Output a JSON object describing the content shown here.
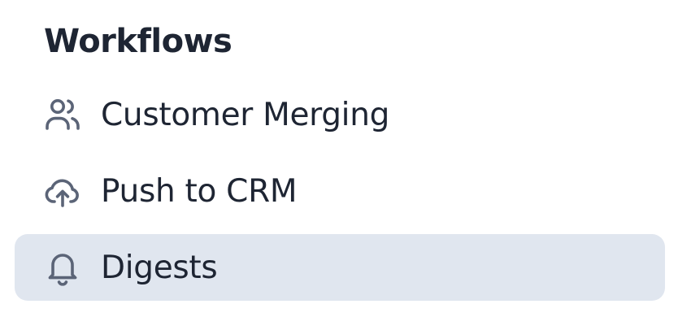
{
  "sidebar": {
    "section_title": "Workflows",
    "items": [
      {
        "label": "Customer Merging",
        "icon": "users-icon",
        "active": false
      },
      {
        "label": "Push to CRM",
        "icon": "cloud-upload-icon",
        "active": false
      },
      {
        "label": "Digests",
        "icon": "bell-icon",
        "active": true
      }
    ]
  },
  "colors": {
    "active_background": "#e0e6ef",
    "text": "#1e2533",
    "icon": "#5b6477"
  }
}
